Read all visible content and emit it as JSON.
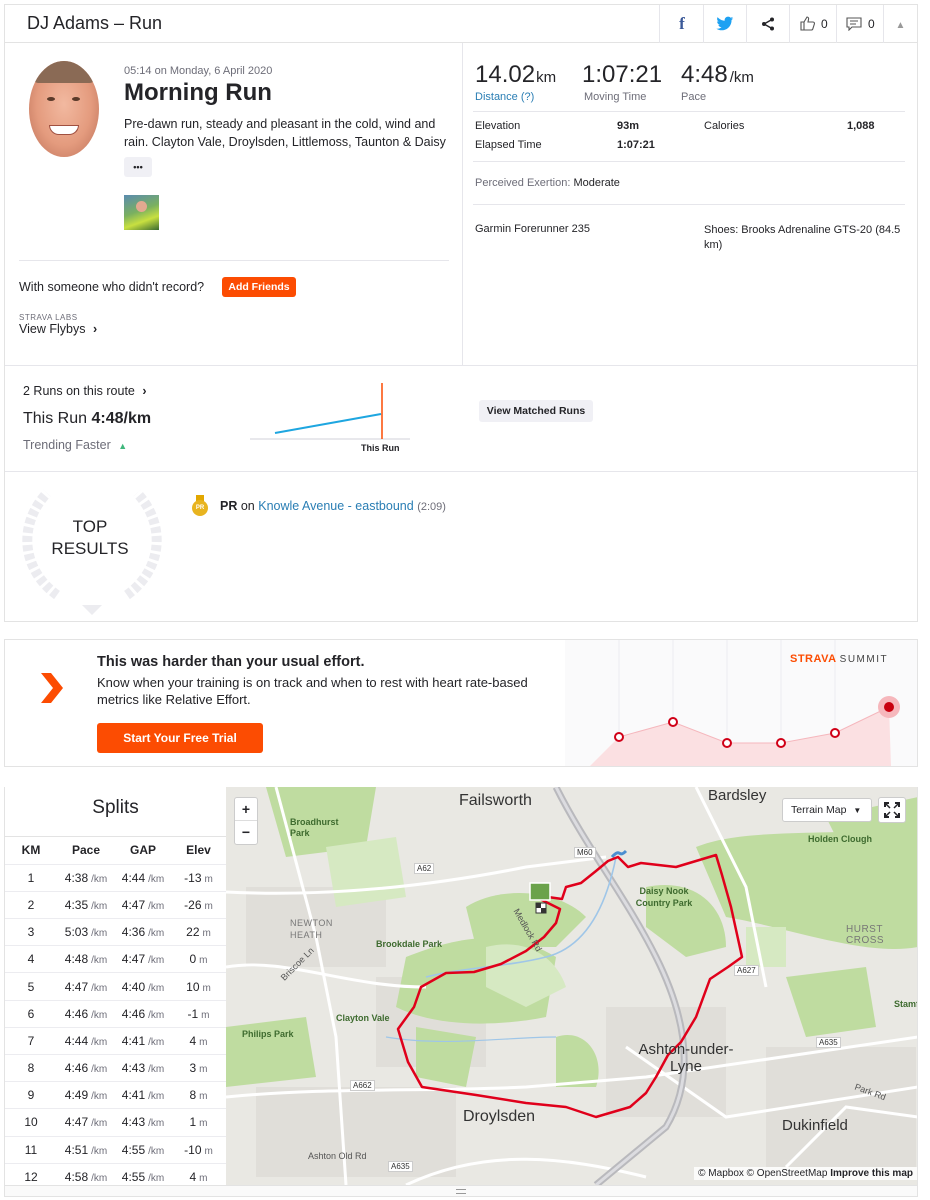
{
  "header": {
    "title": "DJ Adams – Run",
    "kudos_count": "0",
    "comments_count": "0"
  },
  "activity": {
    "datetime": "05:14 on Monday, 6 April 2020",
    "name": "Morning Run",
    "description": "Pre-dawn run, steady and pleasant in the cold, wind and rain. Clayton Vale, Droylsden, Littlemoss, Taunton & Daisy",
    "more_label": "•••",
    "with_someone": "With someone who didn't record?",
    "add_friends": "Add Friends",
    "labs_label": "STRAVA LABS",
    "flybys": "View Flybys"
  },
  "stats": {
    "distance_value": "14.02",
    "distance_unit": "km",
    "distance_label": "Distance (?)",
    "moving_time": "1:07:21",
    "moving_time_label": "Moving Time",
    "pace_value": "4:48",
    "pace_unit": "/km",
    "pace_label": "Pace",
    "elevation_label": "Elevation",
    "elevation_value": "93m",
    "calories_label": "Calories",
    "calories_value": "1,088",
    "elapsed_label": "Elapsed Time",
    "elapsed_value": "1:07:21",
    "exertion_label": "Perceived Exertion:",
    "exertion_value": "Moderate",
    "device": "Garmin Forerunner 235",
    "shoes": "Shoes: Brooks Adrenaline GTS-20 (84.5 km)"
  },
  "route": {
    "runs_on_route": "2 Runs on this route",
    "this_run_label": "This Run",
    "this_run_value": "4:48/km",
    "trending": "Trending Faster",
    "chart_label": "This Run",
    "view_matched": "View Matched Runs"
  },
  "results": {
    "top_label_1": "TOP",
    "top_label_2": "RESULTS",
    "pr_badge": "PR",
    "pr_label": "PR",
    "pr_on": "on",
    "segment": "Knowle Avenue - eastbound",
    "segment_time": "(2:09)"
  },
  "promo": {
    "title": "This was harder than your usual effort.",
    "body": "Know when your training is on track and when to rest with heart rate-based metrics like Relative Effort.",
    "cta": "Start Your Free Trial",
    "brand": "STRAVA",
    "brand_suffix": "SUMMIT"
  },
  "splits": {
    "title": "Splits",
    "headers": [
      "KM",
      "Pace",
      "GAP",
      "Elev"
    ],
    "pace_unit": "/km",
    "elev_unit": "m",
    "rows": [
      {
        "km": "1",
        "pace": "4:38",
        "gap": "4:44",
        "elev": "-13"
      },
      {
        "km": "2",
        "pace": "4:35",
        "gap": "4:47",
        "elev": "-26"
      },
      {
        "km": "3",
        "pace": "5:03",
        "gap": "4:36",
        "elev": "22"
      },
      {
        "km": "4",
        "pace": "4:48",
        "gap": "4:47",
        "elev": "0"
      },
      {
        "km": "5",
        "pace": "4:47",
        "gap": "4:40",
        "elev": "10"
      },
      {
        "km": "6",
        "pace": "4:46",
        "gap": "4:46",
        "elev": "-1"
      },
      {
        "km": "7",
        "pace": "4:44",
        "gap": "4:41",
        "elev": "4"
      },
      {
        "km": "8",
        "pace": "4:46",
        "gap": "4:43",
        "elev": "3"
      },
      {
        "km": "9",
        "pace": "4:49",
        "gap": "4:41",
        "elev": "8"
      },
      {
        "km": "10",
        "pace": "4:47",
        "gap": "4:43",
        "elev": "1"
      },
      {
        "km": "11",
        "pace": "4:51",
        "gap": "4:55",
        "elev": "-10"
      },
      {
        "km": "12",
        "pace": "4:58",
        "gap": "4:55",
        "elev": "4"
      }
    ]
  },
  "map": {
    "zoom_in": "+",
    "zoom_out": "−",
    "terrain_label": "Terrain Map",
    "attribution_1": "© Mapbox © OpenStreetMap",
    "attribution_2": "Improve this map",
    "places": {
      "failsworth": "Failsworth",
      "bardsley": "Bardsley",
      "broadhurst": "Broadhurst Park",
      "holden": "Holden Clough",
      "daisy": "Daisy Nook Country Park",
      "newton": "NEWTON HEATH",
      "brookdale": "Brookdale Park",
      "hurst": "HURST CROSS",
      "clayton": "Clayton Vale",
      "philips": "Philips Park",
      "ashton": "Ashton-under-Lyne",
      "droylsden": "Droylsden",
      "dukinfield": "Dukinfield",
      "ashton_old": "Ashton Old Rd",
      "medlock": "Medlock Rd",
      "briscoe": "Briscoe Ln",
      "park_rd": "Park Rd",
      "stamf": "Stamf",
      "road_a62": "A62",
      "road_a662": "A662",
      "road_a635_1": "A635",
      "road_a635_2": "A635",
      "road_a627": "A627",
      "road_m60": "M60",
      "road_a6": "A6"
    }
  },
  "colors": {
    "accent": "#fc4c02",
    "route": "#e0001b",
    "link": "#2a7eb4",
    "trend": "#3fb77c"
  }
}
